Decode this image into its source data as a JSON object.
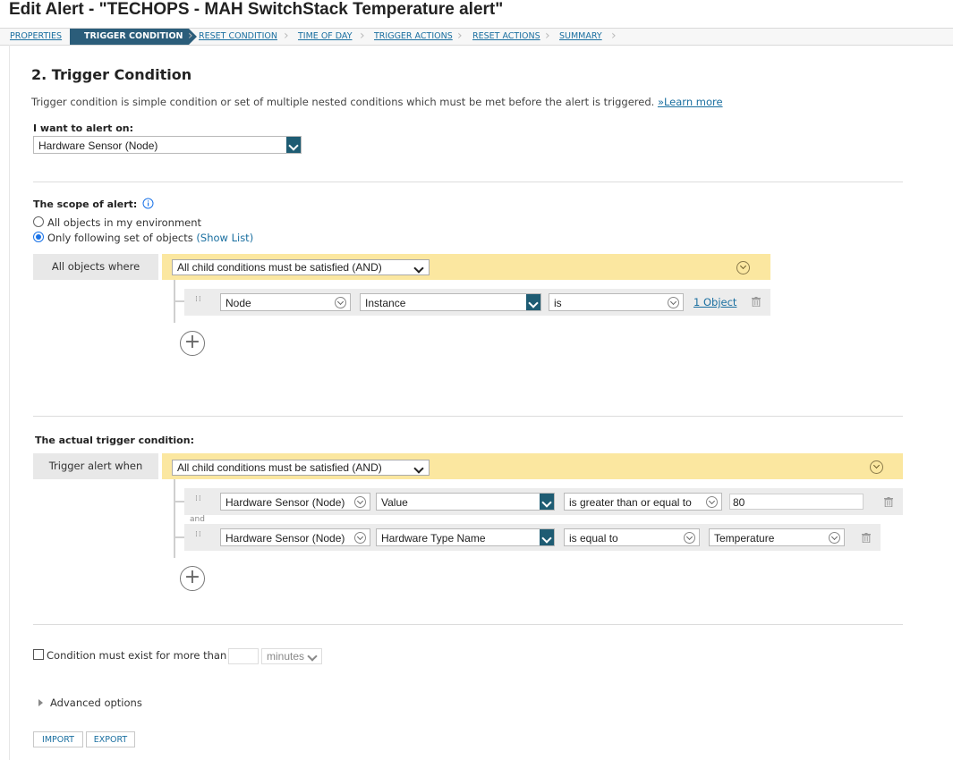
{
  "page_title": "Edit Alert - \"TECHOPS - MAH SwitchStack Temperature alert\"",
  "breadcrumb": [
    "PROPERTIES",
    "TRIGGER CONDITION",
    "RESET CONDITION",
    "TIME OF DAY",
    "TRIGGER ACTIONS",
    "RESET ACTIONS",
    "SUMMARY"
  ],
  "active_step": "TRIGGER CONDITION",
  "section_title": "2. Trigger Condition",
  "description": "Trigger condition is simple condition or set of multiple nested conditions which must be met before the alert is triggered.",
  "learn_more": "»Learn more",
  "alert_on": {
    "label": "I want to alert on:",
    "value": "Hardware Sensor (Node)"
  },
  "scope": {
    "label": "The scope of alert:",
    "options": [
      "All objects in my environment",
      "Only following set of objects"
    ],
    "selected": 1,
    "show_list": "(Show List)",
    "group_label": "All objects where",
    "group_select": "All child conditions must be satisfied (AND)",
    "conditions": [
      {
        "field": "Node",
        "property": "Instance",
        "operator": "is",
        "value_link": "1 Object"
      }
    ]
  },
  "trigger": {
    "label": "The actual trigger condition:",
    "group_label": "Trigger alert when",
    "group_select": "All child conditions must be satisfied (AND)",
    "joiner": "and",
    "conditions": [
      {
        "field": "Hardware Sensor (Node)",
        "property": "Value",
        "operator": "is greater than or equal to",
        "value": "80"
      },
      {
        "field": "Hardware Sensor (Node)",
        "property": "Hardware Type Name",
        "operator": "is equal to",
        "value": "Temperature"
      }
    ]
  },
  "duration": {
    "label": "Condition must exist for more than",
    "value": "",
    "unit": "minutes",
    "checked": false
  },
  "advanced": "Advanced options",
  "buttons": {
    "import": "IMPORT",
    "export": "EXPORT"
  },
  "colors": {
    "accent": "#2b5d7a",
    "group_bar": "#fbe7a0",
    "link": "#1a6fa0",
    "dropdown_button": "#1e5c73"
  },
  "icons": [
    "info-icon",
    "chevron-down-icon",
    "collapse-icon",
    "drag-handle-icon",
    "trash-icon",
    "add-condition-icon",
    "expand-arrow-icon"
  ]
}
